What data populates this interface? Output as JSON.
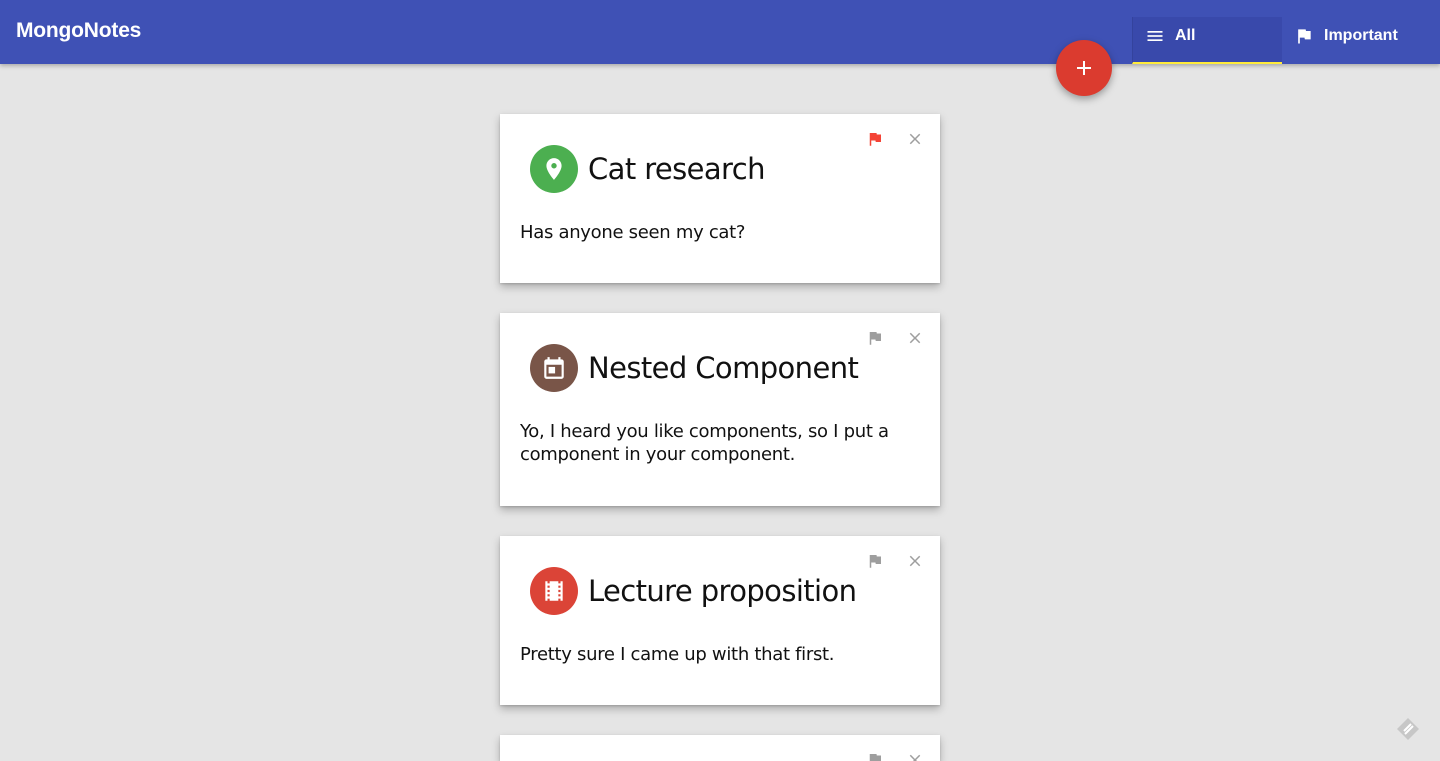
{
  "app": {
    "title": "MongoNotes"
  },
  "tabs": [
    {
      "label": "All",
      "icon": "menu-icon",
      "selected": true
    },
    {
      "label": "Important",
      "icon": "flag-icon",
      "selected": false
    }
  ],
  "fab": {
    "icon": "plus-icon",
    "color": "#db3b2f"
  },
  "colors": {
    "appbar": "#3f51b5",
    "tab_active_indicator": "#ffeb3b",
    "background": "#e5e5e5",
    "flag_important": "#f44336",
    "flag_default": "#9e9e9e"
  },
  "notes": [
    {
      "title": "Cat research",
      "body": "Has anyone seen my cat?",
      "icon": "map-pin-icon",
      "icon_color": "#4caf50",
      "important": true
    },
    {
      "title": "Nested Component",
      "body": "Yo, I heard you like components, so I put a component in your component.",
      "icon": "calendar-icon",
      "icon_color": "#795548",
      "important": false
    },
    {
      "title": "Lecture proposition",
      "body": "Pretty sure I came up with that first.",
      "icon": "film-icon",
      "icon_color": "#db4437",
      "important": false
    },
    {
      "title": "",
      "body": "",
      "icon": "",
      "icon_color": "",
      "important": false
    }
  ]
}
